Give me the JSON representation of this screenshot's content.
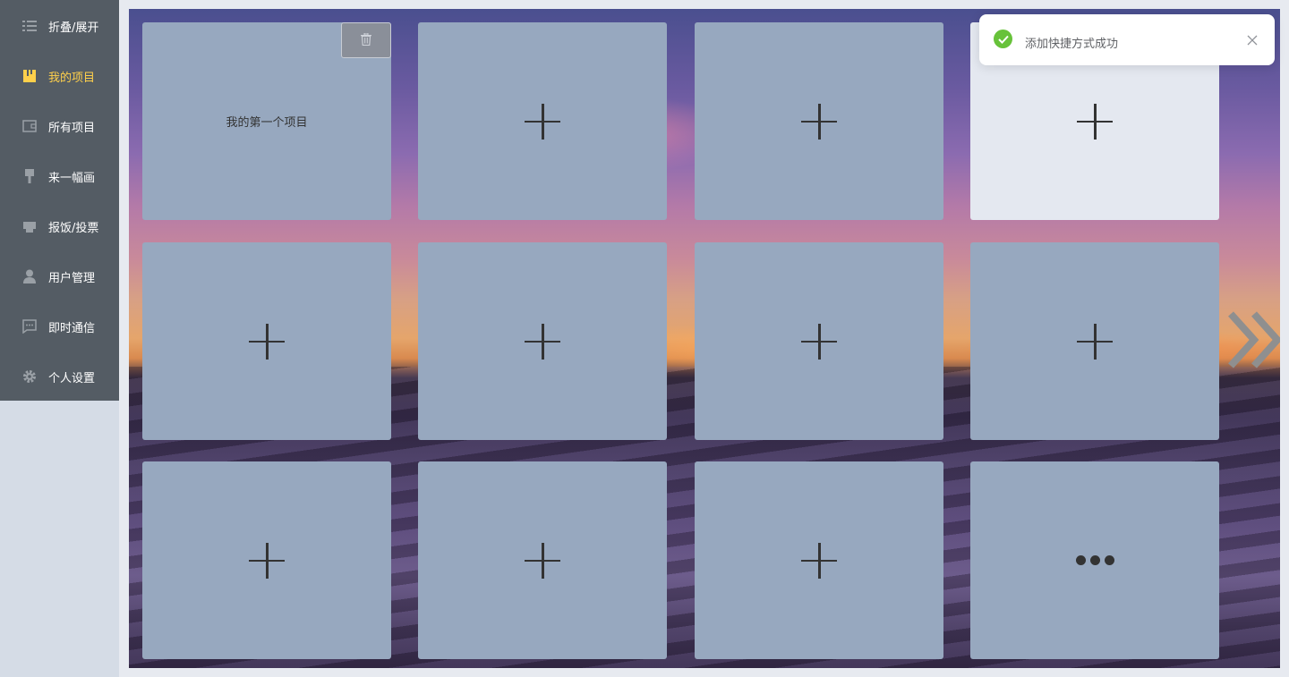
{
  "sidebar": {
    "items": [
      {
        "label": "折叠/展开",
        "icon": "list-icon"
      },
      {
        "label": "我的项目",
        "icon": "folder-icon",
        "active": true
      },
      {
        "label": "所有项目",
        "icon": "wallet-icon"
      },
      {
        "label": "来一幅画",
        "icon": "brush-icon"
      },
      {
        "label": "报饭/投票",
        "icon": "printer-icon"
      },
      {
        "label": "用户管理",
        "icon": "user-icon"
      },
      {
        "label": "即时通信",
        "icon": "chat-icon"
      },
      {
        "label": "个人设置",
        "icon": "gear-icon"
      }
    ],
    "active_color": "#ffd04b",
    "bg_color": "#545c64"
  },
  "tiles": {
    "first_project": "我的第一个项目"
  },
  "notification": {
    "message": "添加快捷方式成功",
    "type": "success",
    "color": "#67c23a"
  }
}
